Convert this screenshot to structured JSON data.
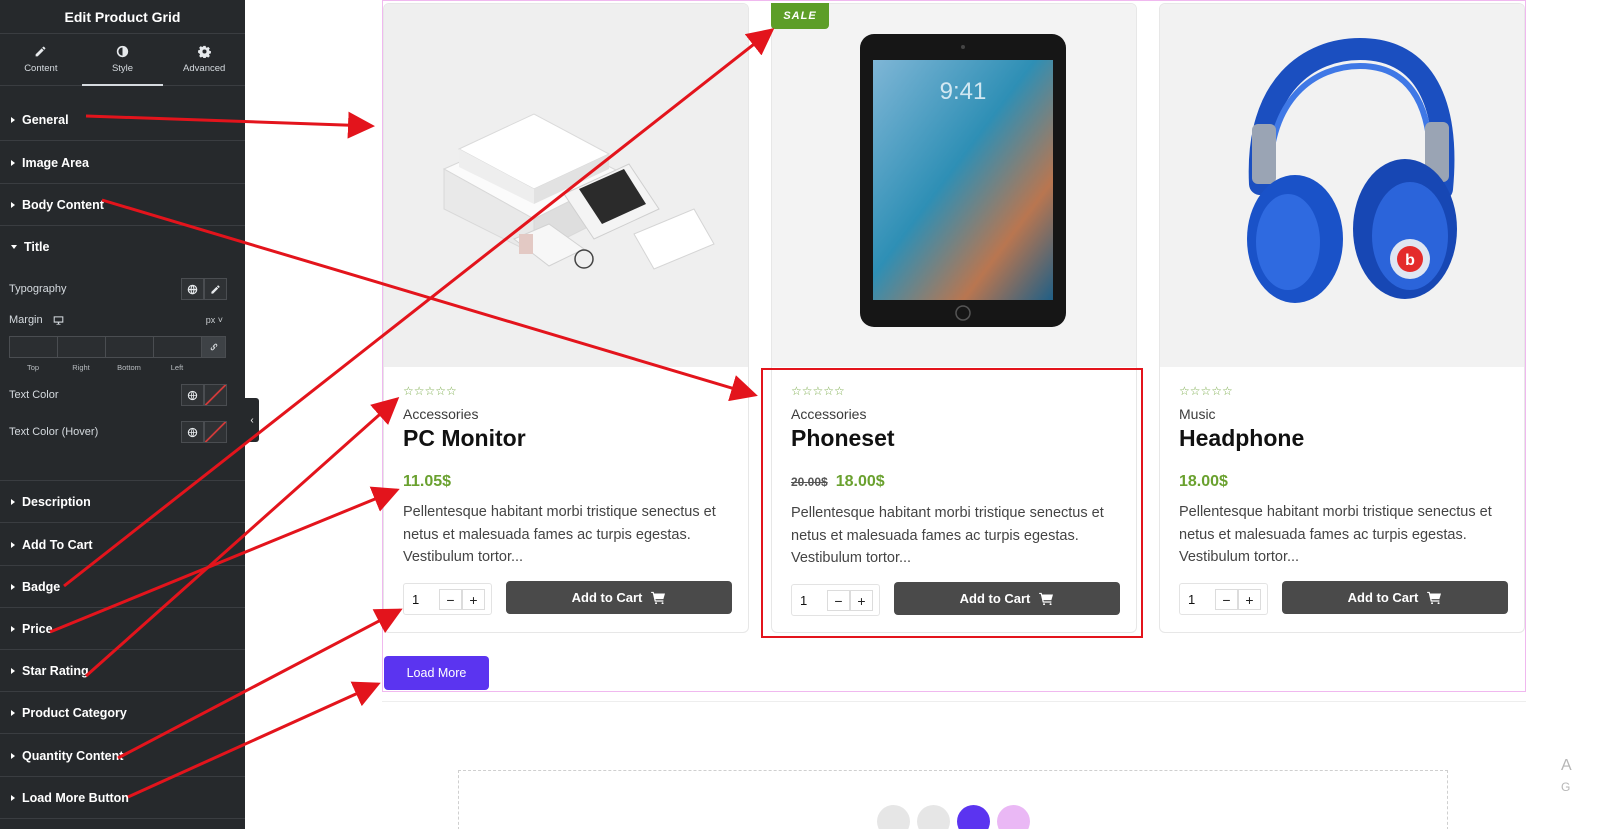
{
  "sidebar": {
    "title": "Edit Product Grid",
    "tabs": [
      {
        "label": "Content",
        "icon": "pencil-icon"
      },
      {
        "label": "Style",
        "icon": "half-circle-icon"
      },
      {
        "label": "Advanced",
        "icon": "gear-icon"
      }
    ],
    "sections": {
      "general": "General",
      "image_area": "Image Area",
      "body_content": "Body Content",
      "title": "Title",
      "description": "Description",
      "add_to_cart": "Add To Cart",
      "badge": "Badge",
      "price": "Price",
      "star_rating": "Star Rating",
      "product_category": "Product Category",
      "quantity_content": "Quantity Content",
      "load_more_button": "Load More Button"
    },
    "controls": {
      "typography": "Typography",
      "margin": "Margin",
      "units": "px",
      "dim_top": "Top",
      "dim_right": "Right",
      "dim_bottom": "Bottom",
      "dim_left": "Left",
      "text_color": "Text Color",
      "text_color_hover": "Text Color (Hover)"
    }
  },
  "products": [
    {
      "stars": "☆☆☆☆☆",
      "category": "Accessories",
      "title": "PC Monitor",
      "old_price": "",
      "price": "11.05$",
      "description": "Pellentesque habitant morbi tristique senectus et netus et malesuada fames ac turpis egestas. Vestibulum tortor...",
      "quantity": "1",
      "cart_label": "Add to Cart"
    },
    {
      "stars": "☆☆☆☆☆",
      "category": "Accessories",
      "title": "Phoneset",
      "old_price": "20.00$",
      "price": "18.00$",
      "description": "Pellentesque habitant morbi tristique senectus et netus et malesuada fames ac turpis egestas. Vestibulum tortor...",
      "quantity": "1",
      "cart_label": "Add to Cart",
      "badge": "SALE"
    },
    {
      "stars": "☆☆☆☆☆",
      "category": "Music",
      "title": "Headphone",
      "old_price": "",
      "price": "18.00$",
      "description": "Pellentesque habitant morbi tristique senectus et netus et malesuada fames ac turpis egestas. Vestibulum tortor...",
      "quantity": "1",
      "cart_label": "Add to Cart"
    }
  ],
  "qty_minus": "−",
  "qty_plus": "+",
  "load_more": "Load More",
  "screen": {
    "time": "9:41"
  },
  "edge_text": {
    "a": "A",
    "g": "G"
  },
  "colors": {
    "sidebar_bg": "#26292c",
    "price_green": "#6aa12f",
    "badge_green": "#5d9e28",
    "load_more_purple": "#5b34f0",
    "annotation_red": "#e3141c",
    "grid_border_pink": "#f0b8ef"
  }
}
